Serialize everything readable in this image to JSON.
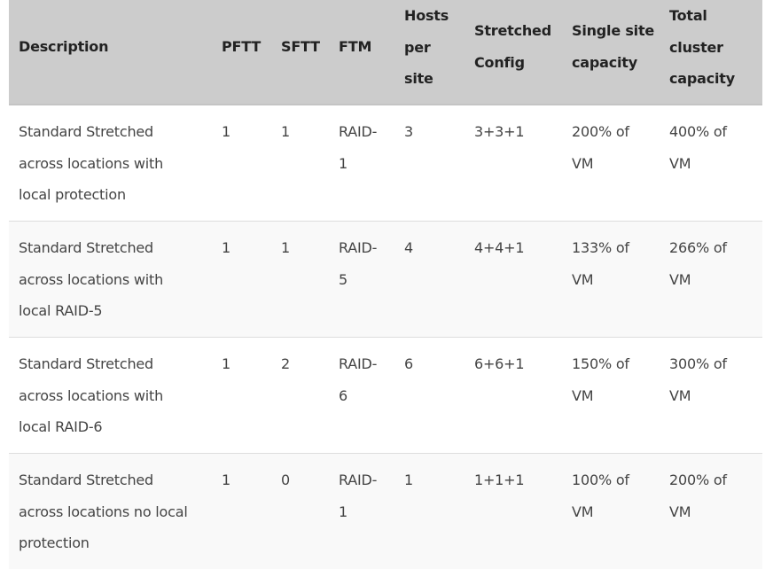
{
  "table": {
    "headers": {
      "description": "Description",
      "pftt": "PFTT",
      "sftt": "SFTT",
      "ftm": "FTM",
      "hosts_1": "Hosts",
      "hosts_2": "per",
      "hosts_3": "site",
      "stretched_1": "Stretched",
      "stretched_2": "Config",
      "single_1": "Single site",
      "single_2": "capacity",
      "total_1": "Total",
      "total_2": "cluster",
      "total_3": "capacity"
    },
    "rows": [
      {
        "desc": [
          "Standard Stretched",
          "across locations with",
          "local protection"
        ],
        "pftt": "1",
        "sftt": "1",
        "ftm": [
          "RAID-",
          "1"
        ],
        "hosts": "3",
        "config": "3+3+1",
        "single": [
          "200% of",
          "VM"
        ],
        "total": [
          "400% of",
          "VM"
        ]
      },
      {
        "desc": [
          "Standard Stretched",
          "across locations with",
          "local RAID-5"
        ],
        "pftt": "1",
        "sftt": "1",
        "ftm": [
          "RAID-",
          "5"
        ],
        "hosts": "4",
        "config": "4+4+1",
        "single": [
          "133% of",
          "VM"
        ],
        "total": [
          "266% of",
          "VM"
        ]
      },
      {
        "desc": [
          "Standard Stretched",
          "across locations with",
          "local RAID-6"
        ],
        "pftt": "1",
        "sftt": "2",
        "ftm": [
          "RAID-",
          "6"
        ],
        "hosts": "6",
        "config": "6+6+1",
        "single": [
          "150% of",
          "VM"
        ],
        "total": [
          "300% of",
          "VM"
        ]
      },
      {
        "desc": [
          "Standard Stretched",
          "across locations no local",
          "protection"
        ],
        "pftt": "1",
        "sftt": "0",
        "ftm": [
          "RAID-",
          "1"
        ],
        "hosts": "1",
        "config": "1+1+1",
        "single": [
          "100% of",
          "VM"
        ],
        "total": [
          "200% of",
          "VM"
        ]
      }
    ]
  }
}
